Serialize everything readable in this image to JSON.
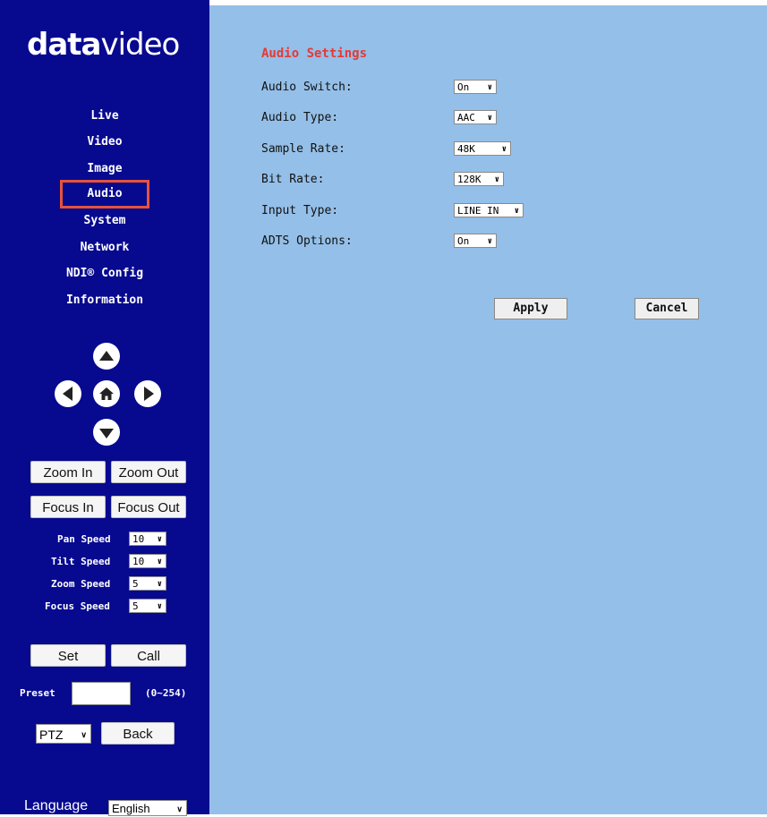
{
  "logo": {
    "bold": "data",
    "thin": "video"
  },
  "nav": [
    {
      "label": "Live"
    },
    {
      "label": "Video"
    },
    {
      "label": "Image"
    },
    {
      "label": "Audio"
    },
    {
      "label": "System"
    },
    {
      "label": "Network"
    },
    {
      "label": "NDI® Config"
    },
    {
      "label": "Information"
    }
  ],
  "ptz": {
    "zoom_in": "Zoom In",
    "zoom_out": "Zoom Out",
    "focus_in": "Focus In",
    "focus_out": "Focus Out",
    "pan_speed_label": "Pan Speed",
    "pan_speed_value": "10",
    "tilt_speed_label": "Tilt Speed",
    "tilt_speed_value": "10",
    "zoom_speed_label": "Zoom Speed",
    "zoom_speed_value": "5",
    "focus_speed_label": "Focus Speed",
    "focus_speed_value": "5",
    "set": "Set",
    "call": "Call",
    "preset_label": "Preset",
    "preset_value": "",
    "preset_range": "(0~254)",
    "mode_value": "PTZ",
    "back": "Back",
    "language_label": "Language",
    "language_value": "English"
  },
  "audio": {
    "title": "Audio Settings",
    "rows": [
      {
        "label": "Audio Switch:",
        "value": "On"
      },
      {
        "label": "Audio Type:",
        "value": "AAC"
      },
      {
        "label": "Sample Rate:",
        "value": "48K"
      },
      {
        "label": "Bit Rate:",
        "value": "128K"
      },
      {
        "label": "Input Type:",
        "value": "LINE IN"
      },
      {
        "label": "ADTS Options:",
        "value": "On"
      }
    ],
    "apply": "Apply",
    "cancel": "Cancel"
  },
  "colors": {
    "sidebar_bg": "#070a8f",
    "main_bg": "#94bfe8",
    "title_red": "#e53935",
    "active_outline": "#e5533d"
  }
}
